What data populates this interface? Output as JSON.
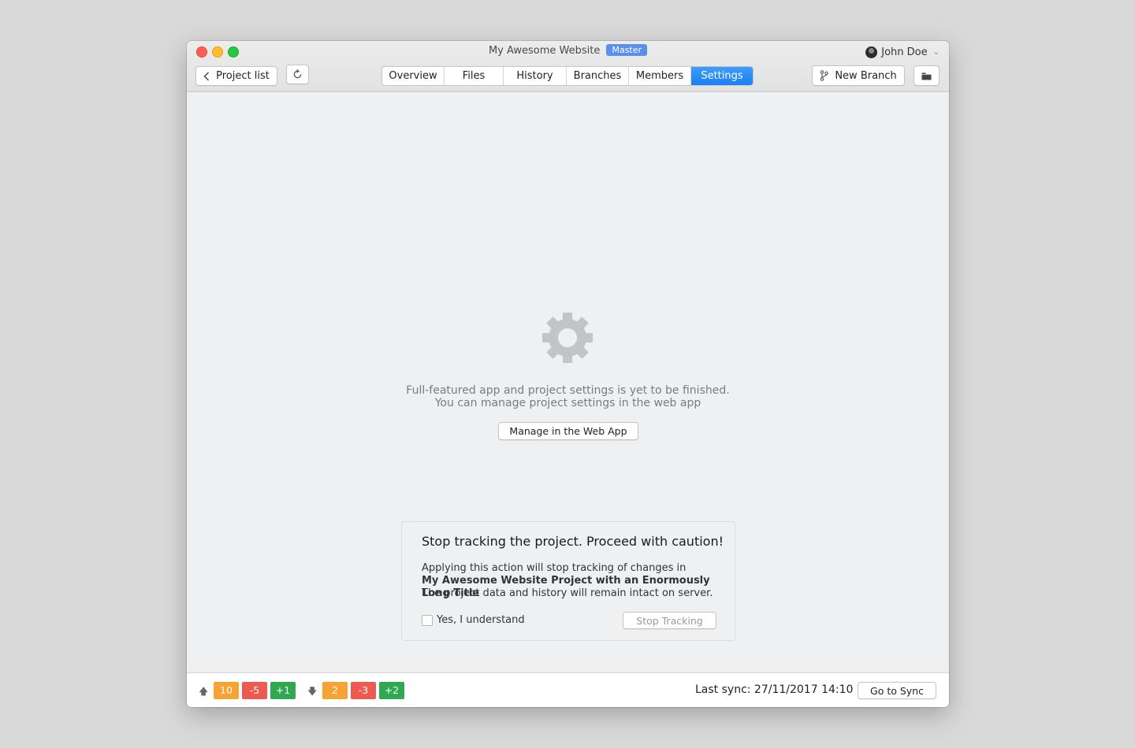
{
  "window": {
    "title": "My Awesome Website",
    "branch_badge": "Master",
    "user_name": "John Doe"
  },
  "toolbar": {
    "back_label": "Project list",
    "refresh_icon": "refresh-icon",
    "new_branch_label": "New Branch",
    "folder_icon": "folder-icon"
  },
  "tabs": [
    {
      "label": "Overview",
      "active": false
    },
    {
      "label": "Files",
      "active": false
    },
    {
      "label": "History",
      "active": false
    },
    {
      "label": "Branches",
      "active": false
    },
    {
      "label": "Members",
      "active": false
    },
    {
      "label": "Settings",
      "active": true
    }
  ],
  "main": {
    "icon": "gear-icon",
    "message_line1": "Full-featured app and project settings is yet to be finished.",
    "message_line2": "You can manage project settings in the web app",
    "webapp_button": "Manage in the Web App"
  },
  "caution": {
    "title": "Stop tracking the project. Proceed with caution!",
    "line1": "Applying this action will stop tracking of changes in",
    "project_name": "My Awesome Website Project with an Enormously Long Title",
    "line3": "The project data and history will remain intact on server.",
    "checkbox_label": "Yes, I understand",
    "checkbox_checked": false,
    "stop_button": "Stop Tracking"
  },
  "status": {
    "upload": {
      "changed": "10",
      "removed": "-5",
      "added": "+1"
    },
    "download": {
      "changed": "2",
      "removed": "-3",
      "added": "+2"
    },
    "last_sync": "Last sync: 27/11/2017 14:10",
    "go_to_sync": "Go to Sync"
  },
  "colors": {
    "accent": "#1b7ff5",
    "badge": "#5a8fee",
    "changed": "#f7a334",
    "removed": "#ee5a52",
    "added": "#2fa850"
  }
}
